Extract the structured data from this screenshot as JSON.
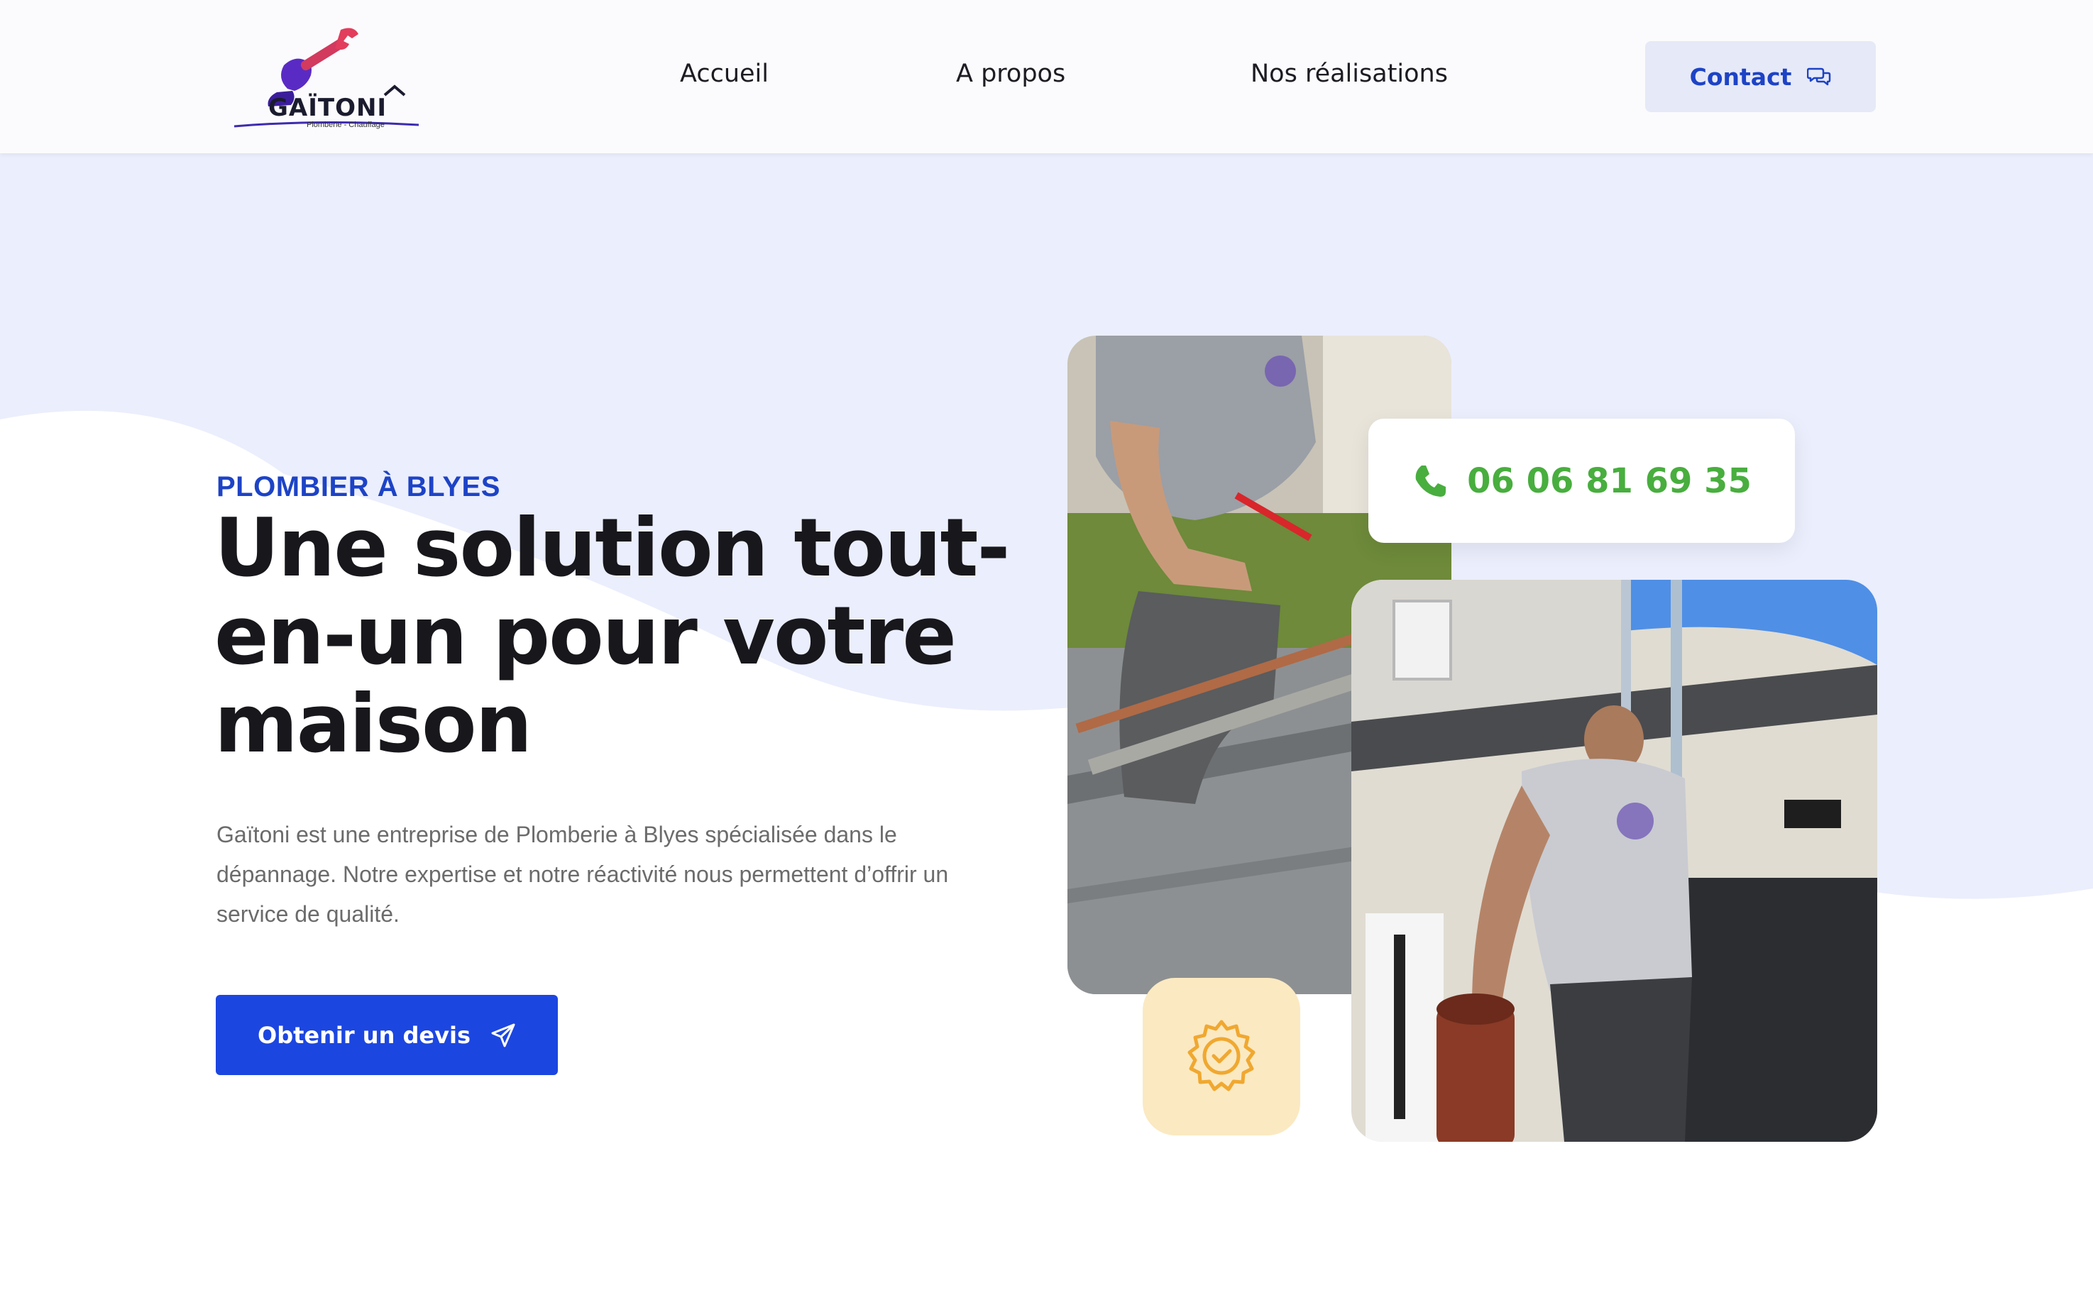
{
  "header": {
    "logo": {
      "wordmark": "GAÏTONI",
      "tagline": "Plomberie - Chauffage"
    },
    "nav": [
      {
        "label": "Accueil"
      },
      {
        "label": "A propos"
      },
      {
        "label": "Nos réalisations"
      }
    ],
    "contact": {
      "label": "Contact",
      "icon": "chat-bubbles-icon"
    }
  },
  "hero": {
    "eyebrow": "PLOMBIER À BLYES",
    "headline": "Une solution tout-en-un pour votre maison",
    "description": "Gaïtoni est une entreprise de Plomberie à Blyes spécialisée dans le dépannage. Notre expertise et notre réactivité nous permettent d’offrir un service de qualité.",
    "cta": {
      "label": "Obtenir un devis",
      "icon": "paper-plane-icon"
    },
    "phone": {
      "number": "06 06 81 69 35",
      "icon": "phone-icon"
    },
    "badge": {
      "icon": "verified-seal-icon"
    }
  },
  "colors": {
    "accent": "#1c46e0",
    "accent_text": "#1d43c6",
    "phone_green": "#48ae3e",
    "wave_lavender": "#ebeefc",
    "badge_bg": "#fbe9c2",
    "badge_icon": "#f0a830"
  }
}
